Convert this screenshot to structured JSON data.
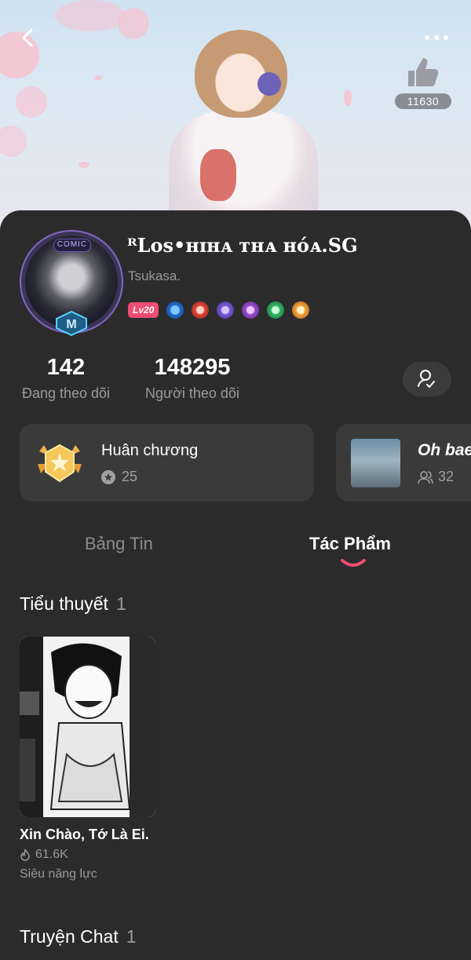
{
  "header": {
    "like_count": "11630"
  },
  "profile": {
    "username": "ᴿLos•ʜɪʜᴀ ᴛʜᴀ ʜóᴀ.SG",
    "subtitle": "Tsukasa.",
    "avatar_frame_text": "COMIC",
    "avatar_badge_letter": "M",
    "level": "Lv20",
    "badge_icons": [
      "water-drop-badge",
      "red-skull-badge",
      "purple-shield-badge",
      "violet-badge",
      "green-gem-badge",
      "orange-sun-badge"
    ]
  },
  "stats": {
    "following_count": "142",
    "following_label": "Đang theo dõi",
    "followers_count": "148295",
    "followers_label": "Người theo dõi"
  },
  "medal": {
    "title": "Huân chương",
    "count": "25"
  },
  "group": {
    "title": "Oh bae",
    "count": "32"
  },
  "tabs": {
    "news": "Bảng Tin",
    "works": "Tác Phẩm",
    "active": "works"
  },
  "novels": {
    "title": "Tiểu thuyết",
    "count": "1",
    "items": [
      {
        "title": "Xin Chào, Tớ Là Ei.",
        "views": "61.6K",
        "genre": "Siêu năng lực"
      }
    ]
  },
  "chat_stories": {
    "title": "Truyện Chat",
    "count": "1"
  },
  "colors": {
    "background": "#2b2b2b",
    "card": "#3a3a3a",
    "accent": "#ef4d72",
    "muted_text": "#9a9a9a"
  }
}
